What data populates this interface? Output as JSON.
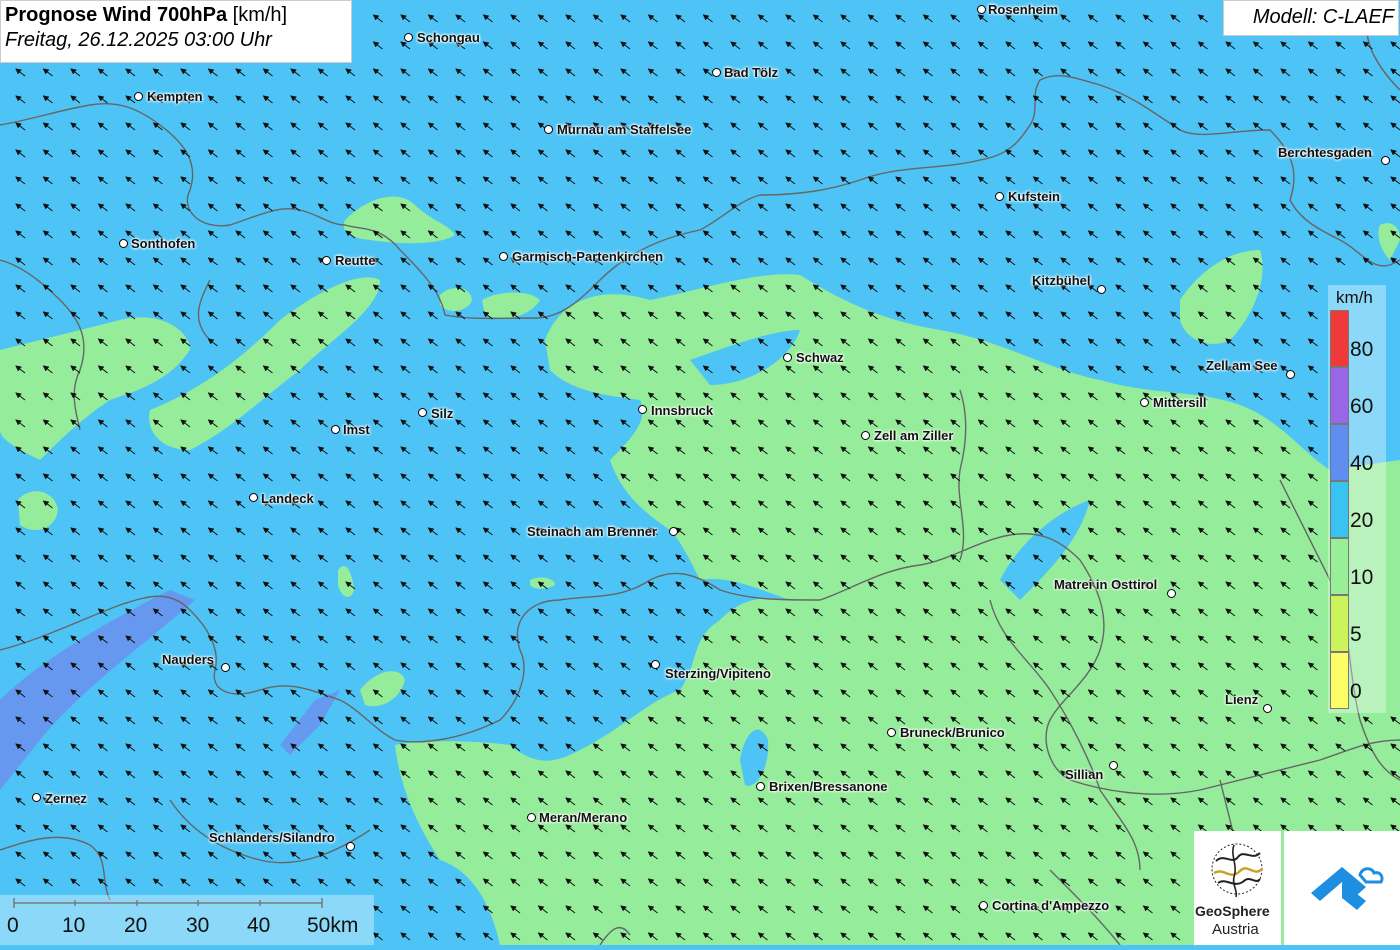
{
  "title": {
    "main": "Prognose Wind 700hPa",
    "unit": "[km/h]",
    "datetime": "Freitag, 26.12.2025 03:00 Uhr"
  },
  "model_label": "Modell: C-LAEF",
  "cities": [
    {
      "name": "Rosenheim",
      "id": "rosenheim"
    },
    {
      "name": "Schongau",
      "id": "schongau"
    },
    {
      "name": "Bad Tölz",
      "id": "bad-toelz"
    },
    {
      "name": "Kempten",
      "id": "kempten"
    },
    {
      "name": "Murnau am Staffelsee",
      "id": "murnau"
    },
    {
      "name": "Berchtesgaden",
      "id": "berchtesgaden"
    },
    {
      "name": "Kufstein",
      "id": "kufstein"
    },
    {
      "name": "Sonthofen",
      "id": "sonthofen"
    },
    {
      "name": "Reutte",
      "id": "reutte"
    },
    {
      "name": "Garmisch-Partenkirchen",
      "id": "garmisch"
    },
    {
      "name": "Kitzbühel",
      "id": "kitzbuehel"
    },
    {
      "name": "Schwaz",
      "id": "schwaz"
    },
    {
      "name": "Zell am See",
      "id": "zell-am-see"
    },
    {
      "name": "Mittersill",
      "id": "mittersill"
    },
    {
      "name": "Innsbruck",
      "id": "innsbruck"
    },
    {
      "name": "Silz",
      "id": "silz"
    },
    {
      "name": "Imst",
      "id": "imst"
    },
    {
      "name": "Zell am Ziller",
      "id": "zell-am-ziller"
    },
    {
      "name": "Landeck",
      "id": "landeck"
    },
    {
      "name": "Steinach am Brenner",
      "id": "steinach"
    },
    {
      "name": "Matrei in Osttirol",
      "id": "matrei"
    },
    {
      "name": "Nauders",
      "id": "nauders"
    },
    {
      "name": "Sterzing/Vipiteno",
      "id": "sterzing"
    },
    {
      "name": "Lienz",
      "id": "lienz"
    },
    {
      "name": "Bruneck/Brunico",
      "id": "bruneck"
    },
    {
      "name": "Sillian",
      "id": "sillian"
    },
    {
      "name": "Brixen/Bressanone",
      "id": "brixen"
    },
    {
      "name": "Zernez",
      "id": "zernez"
    },
    {
      "name": "Meran/Merano",
      "id": "meran"
    },
    {
      "name": "Schlanders/Silandro",
      "id": "schlanders"
    },
    {
      "name": "Cortina d'Ampezzo",
      "id": "cortina"
    }
  ],
  "legend": {
    "unit": "km/h",
    "levels": [
      {
        "label": "80",
        "color": "#f03a3a"
      },
      {
        "label": "60",
        "color": "#9966e8"
      },
      {
        "label": "40",
        "color": "#5f8ef0"
      },
      {
        "label": "20",
        "color": "#38c3f3"
      },
      {
        "label": "10",
        "color": "#98ef98"
      },
      {
        "label": "5",
        "color": "#cbf35a"
      },
      {
        "label": "0",
        "color": "#fdfd68"
      }
    ]
  },
  "scalebar": {
    "labels": [
      "0",
      "10",
      "20",
      "30",
      "40",
      "50km"
    ]
  },
  "logos": {
    "geosphere_name": "GeoSphere",
    "geosphere_sub": "Austria"
  },
  "colors": {
    "field_20_40": "#4dc4f5",
    "field_10_20": "#95ec9a",
    "field_40_60": "#5f8ef0",
    "field_60_80": "#8a7ff0",
    "borders": "#666666",
    "arrows": "#111111"
  }
}
